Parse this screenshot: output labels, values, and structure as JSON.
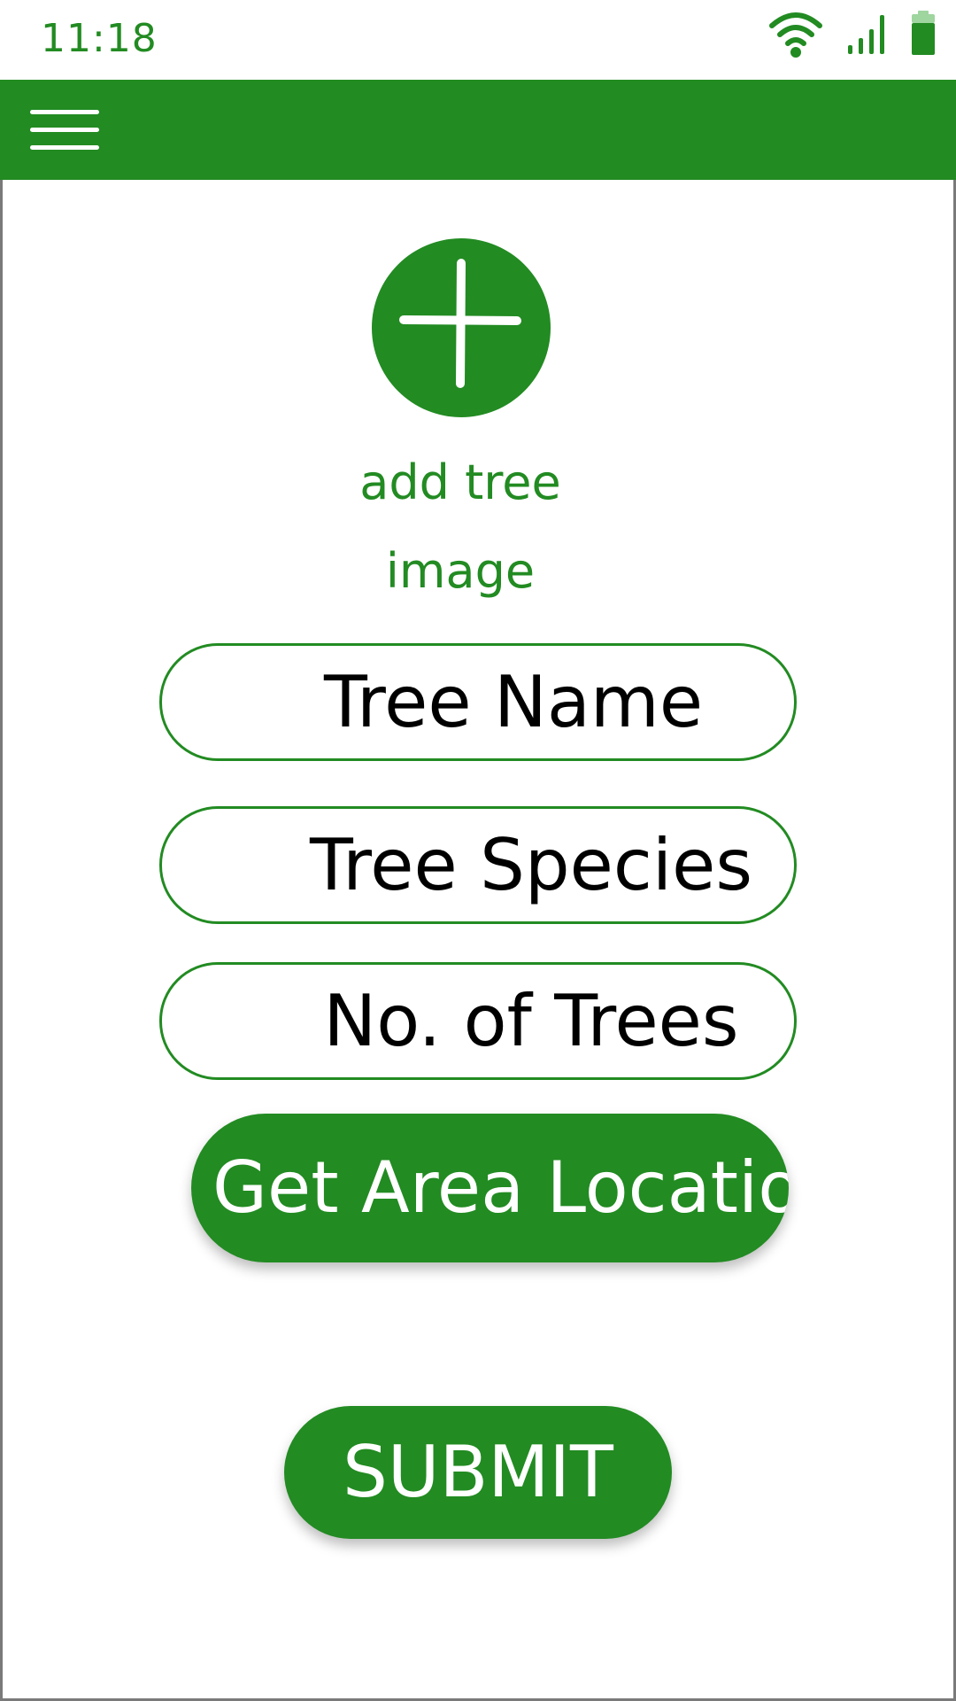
{
  "status_bar": {
    "time": "11:18",
    "icons": [
      "wifi-icon",
      "cellular-signal-icon",
      "battery-icon"
    ],
    "accent_color": "#228b22"
  },
  "app_bar": {
    "menu_icon": "hamburger-menu-icon",
    "background_color": "#228b22"
  },
  "form": {
    "add_image": {
      "icon": "plus-icon",
      "label": "add tree image"
    },
    "fields": {
      "tree_name": {
        "placeholder": "Tree Name"
      },
      "tree_species": {
        "placeholder": "Tree Species"
      },
      "tree_count": {
        "placeholder": "No. of Trees"
      }
    },
    "location_button_label": "Get Area Location",
    "submit_label": "SUBMIT"
  }
}
